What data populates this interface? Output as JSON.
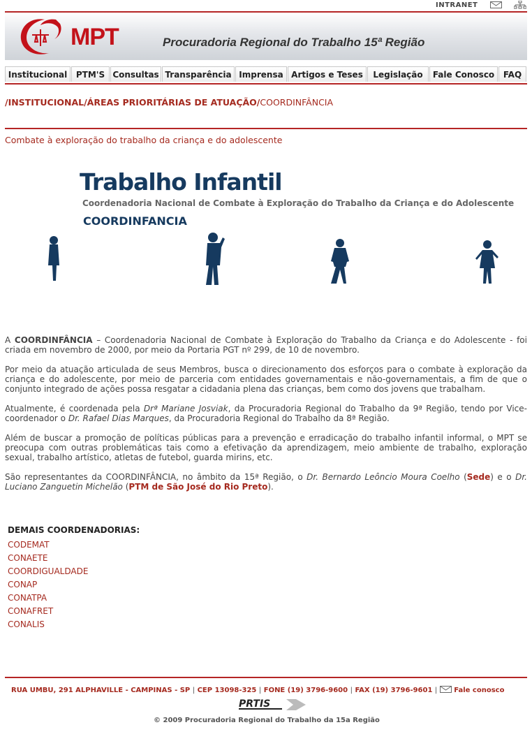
{
  "top": {
    "intranet": "INTRANET",
    "mail_icon": "envelope-icon",
    "sitemap_icon": "sitemap-icon"
  },
  "header": {
    "logo_text": "MPT",
    "title": "Procuradoria Regional do Trabalho 15ª Região",
    "brand_color": "#c3121a"
  },
  "nav": [
    {
      "label": "Institucional"
    },
    {
      "label": "PTM'S"
    },
    {
      "label": "Consultas"
    },
    {
      "label": "Transparência"
    },
    {
      "label": "Imprensa"
    },
    {
      "label": "Artigos e Teses"
    },
    {
      "label": "Legislação"
    },
    {
      "label": "Fale Conosco"
    },
    {
      "label": "FAQ"
    }
  ],
  "breadcrumb": {
    "part1": "/INSTITUCIONAL/ÁREAS PRIORITÁRIAS DE ATUAÇÃO/",
    "part2": "COORDINFÂNCIA"
  },
  "subtitle": "Combate à exploração do trabalho da criança e do adolescente",
  "banner": {
    "title": "Trabalho Infantil",
    "subtitle": "Coordenadoria Nacional de Combate à Exploração do Trabalho da Criança e do Adolescente",
    "acronym": "COORDINFANCIA"
  },
  "paragraphs": {
    "p1_a": "A ",
    "p1_b": "COORDINFÂNCIA",
    "p1_c": " – Coordenadoria Nacional de Combate à Exploração do Trabalho da Criança e do Adolescente - foi criada em novembro de 2000, por meio da Portaria PGT nº 299, de 10 de novembro.",
    "p2": "Por meio da atuação articulada de seus Membros, busca o direcionamento dos esforços para o combate à exploração da criança e do adolescente, por meio de parceria com entidades governamentais e não-governamentais, a fim de que o conjunto integrado de ações possa resgatar a cidadania plena das crianças, bem como dos jovens que trabalham.",
    "p3_a": "Atualmente, é coordenada pela ",
    "p3_b": "Drª Mariane Josviak",
    "p3_c": ", da Procuradoria Regional do Trabalho da 9ª Região, tendo por Vice-coordenador o ",
    "p3_d": "Dr. Rafael Dias Marques",
    "p3_e": ", da Procuradoria Regional do Trabalho da 8ª Região.",
    "p4": "Além de buscar a promoção de políticas públicas para a prevenção e erradicação do trabalho infantil informal, o MPT se preocupa com outras problemáticas tais como a efetivação da aprendizagem, meio ambiente de trabalho, exploração sexual, trabalho artístico, atletas de futebol, guarda mirins, etc.",
    "p5_a": "São representantes da COORDINFÂNCIA, no âmbito da 15ª Região, o ",
    "p5_b": "Dr. Bernardo Leôncio Moura Coelho",
    "p5_c": " (",
    "p5_d": "Sede",
    "p5_e": ") e o ",
    "p5_f": "Dr. Luciano Zanguetin Michelão",
    "p5_g": " (",
    "p5_h": "PTM de São José do Rio Preto",
    "p5_i": ")."
  },
  "demais": {
    "title": "DEMAIS COORDENADORIAS:",
    "items": [
      "CODEMAT",
      "CONAETE",
      "COORDIGUALDADE",
      "CONAP",
      "CONATPA",
      "CONAFRET",
      "CONALIS"
    ]
  },
  "footer": {
    "address": "RUA UMBU, 291 ALPHAVILLE - CAMPINAS - SP",
    "cep": "CEP 13098-325",
    "fone": "FONE (19) 3796-9600",
    "fax": "FAX (19) 3796-9601",
    "fale": "Fale conosco",
    "prtis_logo": "PRTIS",
    "copyright": "© 2009 Procuradoria Regional do Trabalho da 15a Região"
  }
}
